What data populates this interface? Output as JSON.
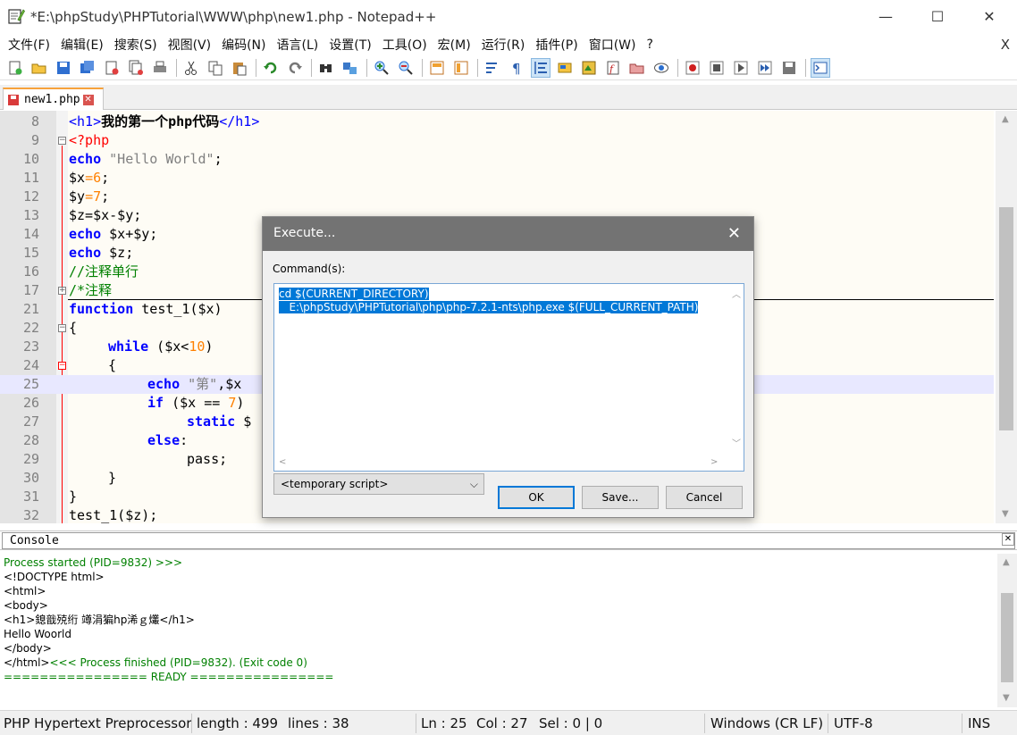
{
  "window": {
    "title": "*E:\\phpStudy\\PHPTutorial\\WWW\\php\\new1.php - Notepad++",
    "minimize": "—",
    "maximize": "☐",
    "close": "✕"
  },
  "menu": {
    "items": [
      "文件(F)",
      "编辑(E)",
      "搜索(S)",
      "视图(V)",
      "编码(N)",
      "语言(L)",
      "设置(T)",
      "工具(O)",
      "宏(M)",
      "运行(R)",
      "插件(P)",
      "窗口(W)",
      "?"
    ],
    "close": "X"
  },
  "tab": {
    "label": "new1.php",
    "close": "✕"
  },
  "editor": {
    "lines": [
      {
        "no": "8"
      },
      {
        "no": "9"
      },
      {
        "no": "10"
      },
      {
        "no": "11"
      },
      {
        "no": "12"
      },
      {
        "no": "13"
      },
      {
        "no": "14"
      },
      {
        "no": "15"
      },
      {
        "no": "16"
      },
      {
        "no": "17"
      },
      {
        "no": "21"
      },
      {
        "no": "22"
      },
      {
        "no": "23"
      },
      {
        "no": "24"
      },
      {
        "no": "25"
      },
      {
        "no": "26"
      },
      {
        "no": "27"
      },
      {
        "no": "28"
      },
      {
        "no": "29"
      },
      {
        "no": "30"
      },
      {
        "no": "31"
      },
      {
        "no": "32"
      }
    ],
    "code": {
      "l8_open": "<h1>",
      "l8_text": "我的第一个php代码",
      "l8_close": "</h1>",
      "l9": "<?php",
      "l10_kw": "echo",
      "l10_str": "\"Hello World\"",
      "l10_end": ";",
      "l11_var": "$x",
      "l11_eq": "=",
      "l11_num": "6",
      "l11_end": ";",
      "l12_var": "$y",
      "l12_eq": "=",
      "l12_num": "7",
      "l12_end": ";",
      "l13": "$z=$x-$y;",
      "l14_kw": "echo",
      "l14_rest": " $x+$y;",
      "l15_kw": "echo",
      "l15_rest": " $z;",
      "l16": "//注释单行",
      "l17": "/*注释",
      "l21_kw": "function",
      "l21_rest": " test_1($x)",
      "l22": "{",
      "l23_kw": "while",
      "l23_a": " ($x<",
      "l23_num": "10",
      "l23_b": ")",
      "l24": "{",
      "l25_kw": "echo",
      "l25_str": " \"第\"",
      "l25_rest": ",$x",
      "l26_kw": "if",
      "l26_a": " ($x == ",
      "l26_num": "7",
      "l26_b": ")",
      "l27_kw": "static",
      "l27_rest": " $",
      "l28_kw": "else",
      "l28_rest": ":",
      "l29": "pass;",
      "l30": "}",
      "l31": "}",
      "l32": "test_1($z);"
    }
  },
  "dialog": {
    "title": "Execute...",
    "close": "✕",
    "label": "Command(s):",
    "command_line1": "cd $(CURRENT_DIRECTORY)",
    "command_line2": "   E:\\phpStudy\\PHPTutorial\\php\\php-7.2.1-nts\\php.exe $(FULL_CURRENT_PATH)",
    "script_select": "<temporary script>",
    "ok": "OK",
    "save": "Save...",
    "cancel": "Cancel"
  },
  "console": {
    "title": "Console",
    "close": "✕",
    "lines": {
      "l1": "Process started (PID=9832) >>>",
      "l2": "<!DOCTYPE html>",
      "l3": "<html>",
      "l4": "<body>",
      "l5": "<h1>鎴戠殑绗 竴涓猵hp浠ｇ爜</h1>",
      "l6": "Hello Woorld",
      "l7": "</body>",
      "l8a": "</html>",
      "l8b": "<<< Process finished (PID=9832). (Exit code 0)",
      "l9": "================ READY ================"
    }
  },
  "status": {
    "language": "PHP Hypertext Preprocessor",
    "length": "length : 499",
    "lines": "lines : 38",
    "ln": "Ln : 25",
    "col": "Col : 27",
    "sel": "Sel : 0 | 0",
    "eol": "Windows (CR LF)",
    "encoding": "UTF-8",
    "mode": "INS"
  }
}
